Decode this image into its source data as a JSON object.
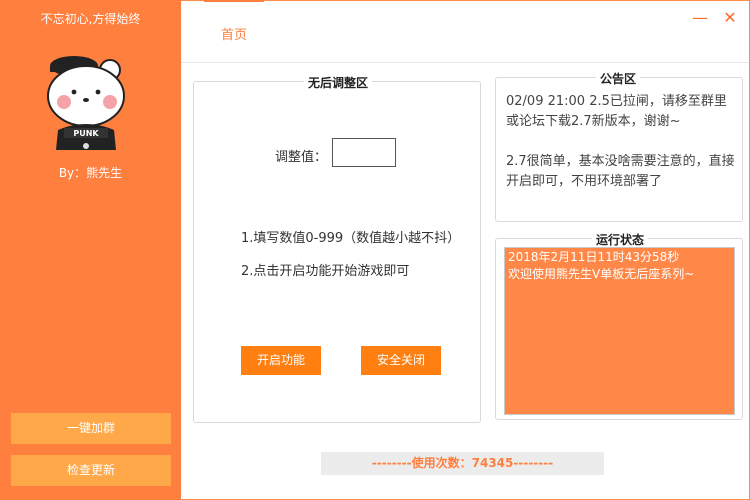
{
  "sidebar": {
    "app_title": "不忘初心,方得始终",
    "avatar_caption": "PUNK",
    "author": "By：熊先生",
    "join_group_label": "一键加群",
    "check_update_label": "检查更新"
  },
  "header": {
    "tab_home": "首页",
    "minimize_glyph": "—",
    "close_glyph": "✕"
  },
  "adjust_panel": {
    "title": "无后调整区",
    "adjust_label": "调整值：",
    "adjust_value": "",
    "tip1": "1.填写数值0-999（数值越小越不抖）",
    "tip2": "2.点击开启功能开始游戏即可",
    "start_label": "开启功能",
    "safe_close_label": "安全关闭"
  },
  "notice_panel": {
    "title": "公告区",
    "text": "02/09 21:00 2.5已拉闸，请移至群里或论坛下载2.7新版本，谢谢~\n\n2.7很简单，基本没啥需要注意的，直接开启即可，不用环境部署了"
  },
  "status_panel": {
    "title": "运行状态",
    "log": "2018年2月11日11时43分58秒\n欢迎使用熊先生V单板无后座系列~"
  },
  "footer": {
    "usage_text": "--------使用次数：74345--------"
  },
  "colors": {
    "accent": "#ff7f3f",
    "button": "#ff7f10",
    "side_button": "#ffa84a",
    "status_bg": "#ff8848"
  },
  "icons": {
    "avatar": "bear-punk-avatar-icon",
    "minimize": "minimize-icon",
    "close": "close-icon"
  }
}
